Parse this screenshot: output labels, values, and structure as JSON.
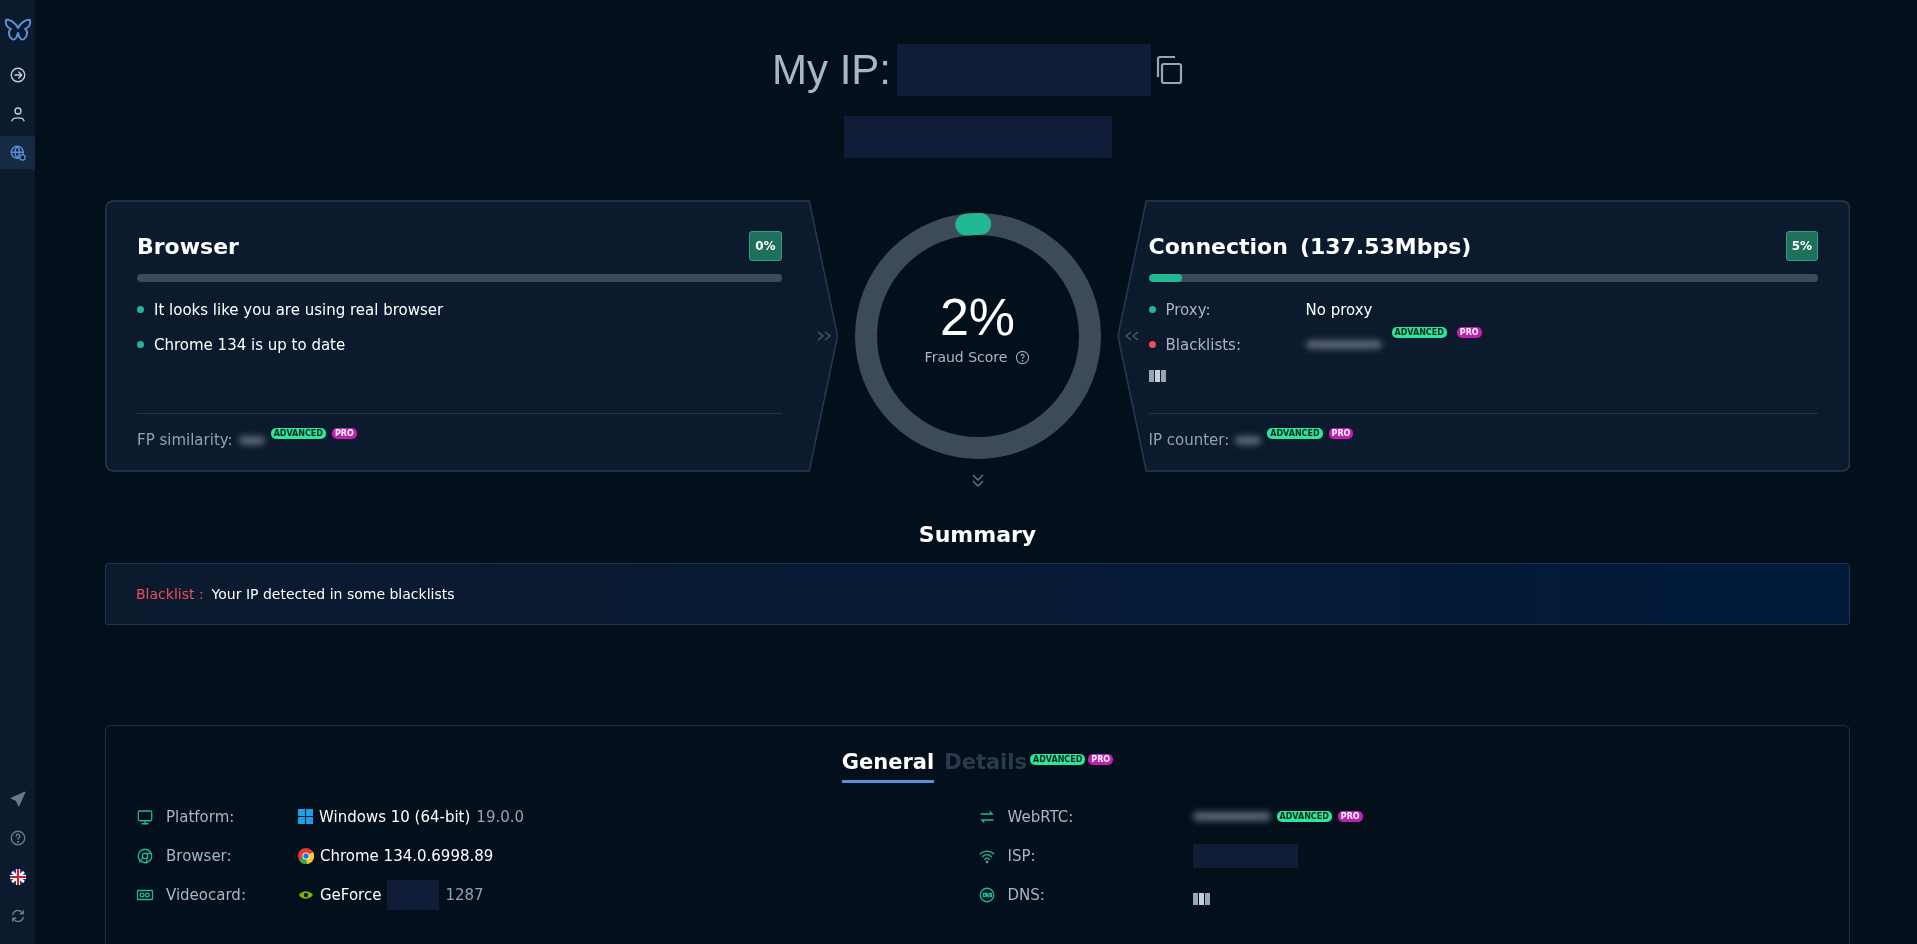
{
  "sidebar": {
    "items": [
      {
        "selected": false
      },
      {
        "selected": false
      },
      {
        "selected": true
      }
    ]
  },
  "header": {
    "title": "My IP:"
  },
  "browser_card": {
    "title": "Browser",
    "score": "0%",
    "level": 0,
    "items": [
      {
        "text": "It looks like you are using real browser",
        "color": "#1fb893"
      },
      {
        "text": "Chrome 134 is up to date",
        "color": "#1fb893"
      }
    ],
    "footer_label": "FP similarity:",
    "footer_badges": [
      "ADVANCED",
      "PRO"
    ]
  },
  "gauge": {
    "value": "2%",
    "label": "Fraud Score",
    "level": 0.02
  },
  "connection_card": {
    "title": "Connection",
    "speed": "(137.53Mbps)",
    "score": "5%",
    "level": 0.05,
    "items": [
      {
        "label": "Proxy:",
        "value": "No proxy",
        "color": "#1fb893",
        "blurred": false
      },
      {
        "label": "Blacklists:",
        "color": "#ef4d5a",
        "blurred": true,
        "badges": [
          "ADVANCED",
          "PRO"
        ]
      }
    ],
    "footer_label": "IP counter:",
    "footer_badges": [
      "ADVANCED",
      "PRO"
    ]
  },
  "summary": {
    "title": "Summary",
    "alerts": [
      {
        "label": "Blacklist :",
        "message": "Your IP detected in some blacklists"
      }
    ]
  },
  "details_panel": {
    "tabs": [
      {
        "label": "General",
        "selected": true
      },
      {
        "label": "Details",
        "selected": false,
        "badges": [
          "ADVANCED",
          "PRO"
        ]
      }
    ],
    "left_rows": [
      {
        "label": "Platform:",
        "value": "Windows 10 (64-bit)",
        "redacted": false,
        "note": "19.0.0"
      },
      {
        "label": "Browser:",
        "value": "Chrome 134.0.6998.89",
        "redacted": false
      },
      {
        "label": "Videocard:",
        "value": "GeForce",
        "redacted": true,
        "note": "1287"
      }
    ],
    "right_rows": [
      {
        "label": "WebRTC:",
        "badges": [
          "ADVANCED",
          "PRO"
        ]
      },
      {
        "label": "ISP:"
      },
      {
        "label": "DNS:"
      }
    ]
  }
}
